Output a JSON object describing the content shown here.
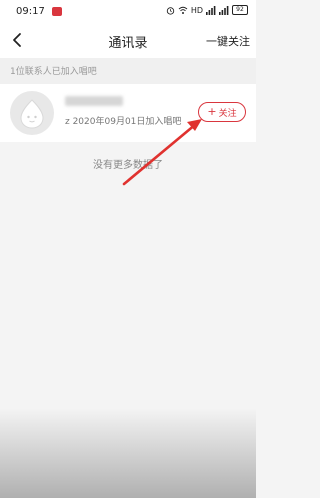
{
  "status": {
    "time": "09:17",
    "network": "HD",
    "battery": "92"
  },
  "nav": {
    "title": "通讯录",
    "follow_all": "一键关注"
  },
  "section": {
    "joined_text": "1位联系人已加入唱吧"
  },
  "contacts": [
    {
      "name": "",
      "subtitle": "z 2020年09月01日加入唱吧",
      "follow_label": "关注"
    }
  ],
  "footer": {
    "no_more": "没有更多数据了"
  },
  "colors": {
    "accent": "#d9363e",
    "annotation_arrow": "#e0322f"
  }
}
